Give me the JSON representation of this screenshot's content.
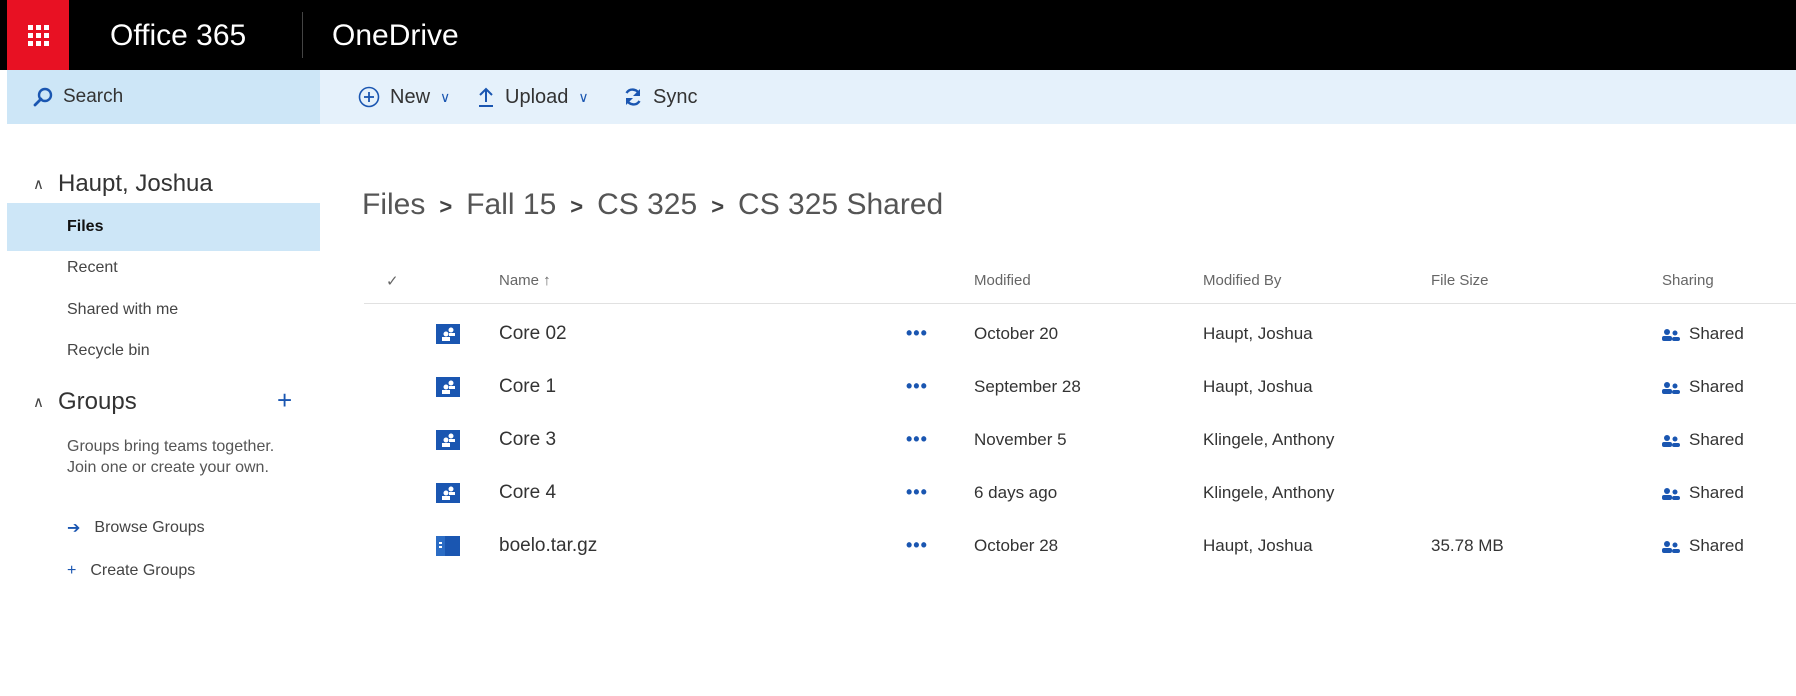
{
  "suite": {
    "brand": "Office 365",
    "app": "OneDrive"
  },
  "search": {
    "label": "Search"
  },
  "commands": {
    "new_label": "New",
    "upload_label": "Upload",
    "sync_label": "Sync"
  },
  "nav": {
    "user": "Haupt, Joshua",
    "items": [
      "Files",
      "Recent",
      "Shared with me",
      "Recycle bin"
    ],
    "groups_title": "Groups",
    "groups_text": "Groups bring teams together. Join one or create your own.",
    "browse_groups": "Browse Groups",
    "create_groups": "Create Groups"
  },
  "breadcrumb": [
    "Files",
    "Fall 15",
    "CS 325",
    "CS 325 Shared"
  ],
  "columns": {
    "name": "Name ↑",
    "modified": "Modified",
    "modified_by": "Modified By",
    "file_size": "File Size",
    "sharing": "Sharing"
  },
  "files": [
    {
      "icon": "shared-folder-icon",
      "name": "Core 02",
      "more": "•••",
      "modified": "October 20",
      "modified_by": "Haupt, Joshua",
      "size": "",
      "sharing": "Shared"
    },
    {
      "icon": "shared-folder-icon",
      "name": "Core 1",
      "more": "•••",
      "modified": "September 28",
      "modified_by": "Haupt, Joshua",
      "size": "",
      "sharing": "Shared"
    },
    {
      "icon": "shared-folder-icon",
      "name": "Core 3",
      "more": "•••",
      "modified": "November 5",
      "modified_by": "Klingele, Anthony",
      "size": "",
      "sharing": "Shared"
    },
    {
      "icon": "shared-folder-icon",
      "name": "Core 4",
      "more": "•••",
      "modified": "6 days ago",
      "modified_by": "Klingele, Anthony",
      "size": "",
      "sharing": "Shared"
    },
    {
      "icon": "archive-file-icon",
      "name": "boelo.tar.gz",
      "more": "•••",
      "modified": "October 28",
      "modified_by": "Haupt, Joshua",
      "size": "35.78 MB",
      "sharing": "Shared"
    }
  ],
  "colors": {
    "waffle": "#e81123",
    "accent": "#1a56b1",
    "selected_bg": "#cde6f7",
    "cmdbar_bg": "#e5f1fb"
  }
}
